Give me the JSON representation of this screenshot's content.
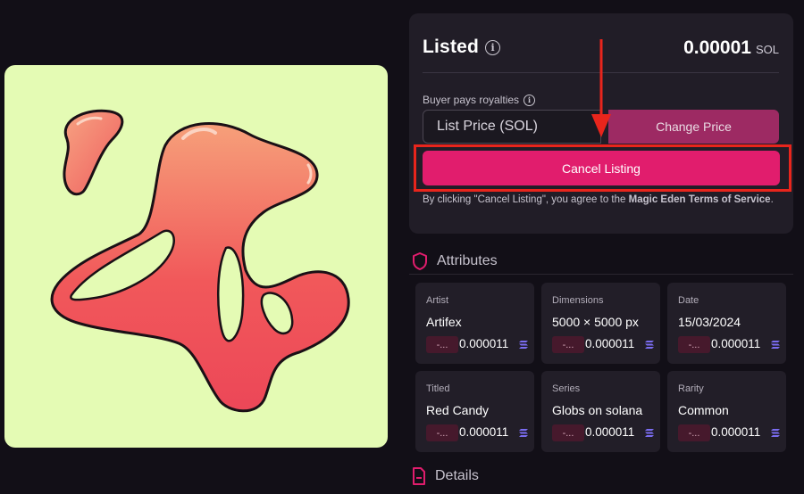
{
  "listing": {
    "status": "Listed",
    "price": "0.00001",
    "currency": "SOL",
    "royalties_label": "Buyer pays royalties",
    "list_price_placeholder": "List Price (SOL)",
    "change_price_label": "Change Price",
    "cancel_label": "Cancel Listing",
    "terms_prefix": "By clicking \"Cancel Listing\", you agree to the ",
    "terms_link": "Magic Eden Terms of Service",
    "terms_suffix": "."
  },
  "attributes": {
    "heading": "Attributes",
    "items": [
      {
        "type": "Artist",
        "value": "Artifex",
        "floor": "-...",
        "price": "0.000011"
      },
      {
        "type": "Dimensions",
        "value": "5000 × 5000 px",
        "floor": "-...",
        "price": "0.000011"
      },
      {
        "type": "Date",
        "value": "15/03/2024",
        "floor": "-...",
        "price": "0.000011"
      },
      {
        "type": "Titled",
        "value": "Red Candy",
        "floor": "-...",
        "price": "0.000011"
      },
      {
        "type": "Series",
        "value": "Globs on solana",
        "floor": "-...",
        "price": "0.000011"
      },
      {
        "type": "Rarity",
        "value": "Common",
        "floor": "-...",
        "price": "0.000011"
      }
    ]
  },
  "details": {
    "heading": "Details"
  },
  "icons": {
    "info": "info-circle-icon",
    "attributes": "shield-icon",
    "details": "document-icon",
    "sol": "solana-icon",
    "annotation": "red-arrow"
  },
  "colors": {
    "background": "#120f17",
    "panel": "#211d27",
    "accent_pink": "#e11d6d",
    "change_price": "#9d2a63",
    "highlight_red": "#e8251c",
    "artwork_bg": "#e4fbb4"
  }
}
